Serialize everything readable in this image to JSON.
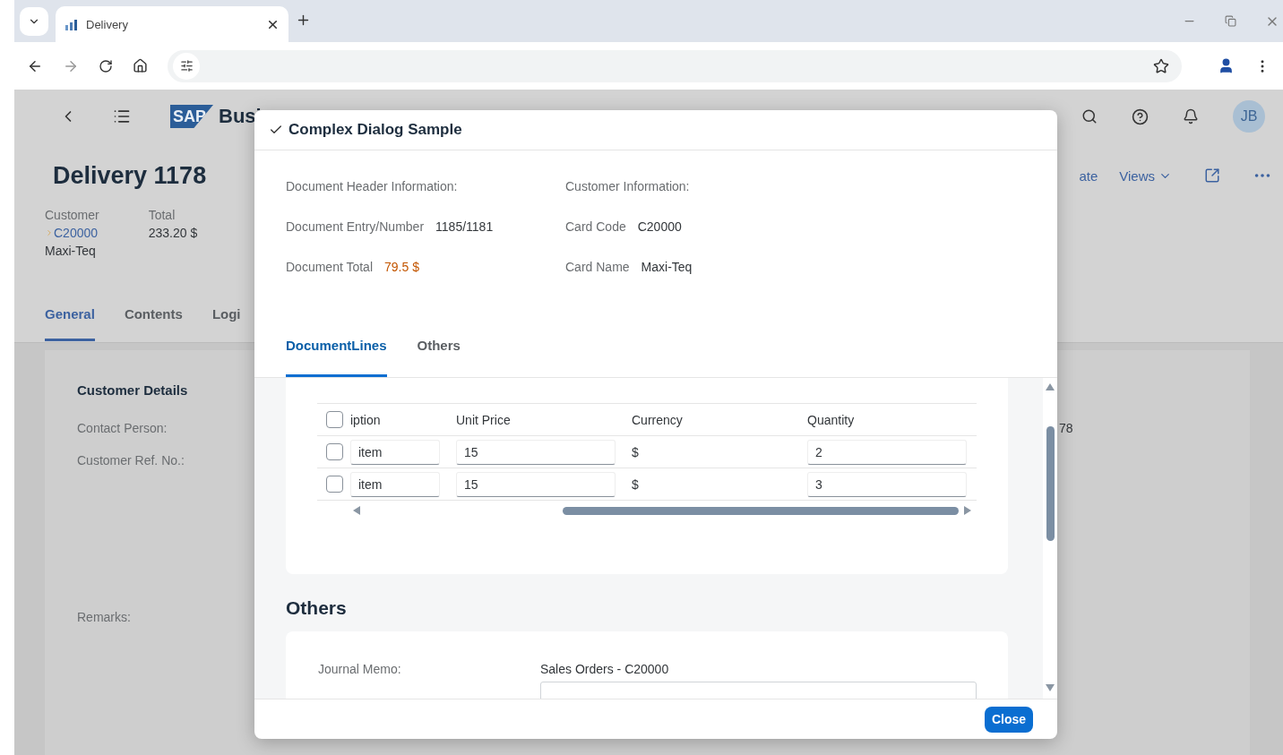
{
  "browser": {
    "tab_title": "Delivery"
  },
  "shell": {
    "logo_text": "SAP",
    "brand_text": "Busi",
    "avatar": "JB"
  },
  "header": {
    "title": "Delivery 1178",
    "actions": [
      {
        "label": "ate",
        "kind": "text"
      },
      {
        "label": "Views",
        "kind": "menu"
      }
    ]
  },
  "attributes": [
    {
      "label": "Customer",
      "link": "C20000",
      "value": "Maxi-Teq"
    },
    {
      "label": "Total",
      "value": "233.20 $"
    }
  ],
  "tabs": [
    {
      "label": "General",
      "selected": true
    },
    {
      "label": "Contents",
      "selected": false
    },
    {
      "label": "Logi",
      "selected": false
    }
  ],
  "section": {
    "title": "Customer Details",
    "fields": [
      {
        "label": "Contact Person:",
        "value": "78"
      },
      {
        "label": "Customer Ref. No.:"
      }
    ],
    "remarks_label": "Remarks:"
  },
  "dialog": {
    "title": "Complex Dialog Sample",
    "info_columns": [
      {
        "heading": "Document Header Information:",
        "fields": [
          {
            "label": "Document Entry/Number",
            "value": "1185/1181",
            "kind": "plain"
          },
          {
            "label": "Document Total",
            "value": "79.5 $",
            "kind": "amount"
          }
        ]
      },
      {
        "heading": "Customer Information:",
        "fields": [
          {
            "label": "Card Code",
            "value": "C20000",
            "kind": "plain"
          },
          {
            "label": "Card Name",
            "value": "Maxi-Teq",
            "kind": "plain"
          }
        ]
      }
    ],
    "tabs": [
      {
        "label": "DocumentLines",
        "selected": true
      },
      {
        "label": "Others",
        "selected": false
      }
    ],
    "table": {
      "select_all_checked": false,
      "columns": [
        "iption",
        "Unit Price",
        "Currency",
        "Quantity"
      ],
      "rows": [
        {
          "checked": false,
          "description": "item",
          "unit_price": "15",
          "currency": "$",
          "quantity": "2"
        },
        {
          "checked": false,
          "description": "item",
          "unit_price": "15",
          "currency": "$",
          "quantity": "3"
        }
      ]
    },
    "others": {
      "title": "Others",
      "fields": [
        {
          "label": "Journal Memo:",
          "value": "Sales Orders - C20000"
        }
      ]
    },
    "close_button": "Close"
  }
}
